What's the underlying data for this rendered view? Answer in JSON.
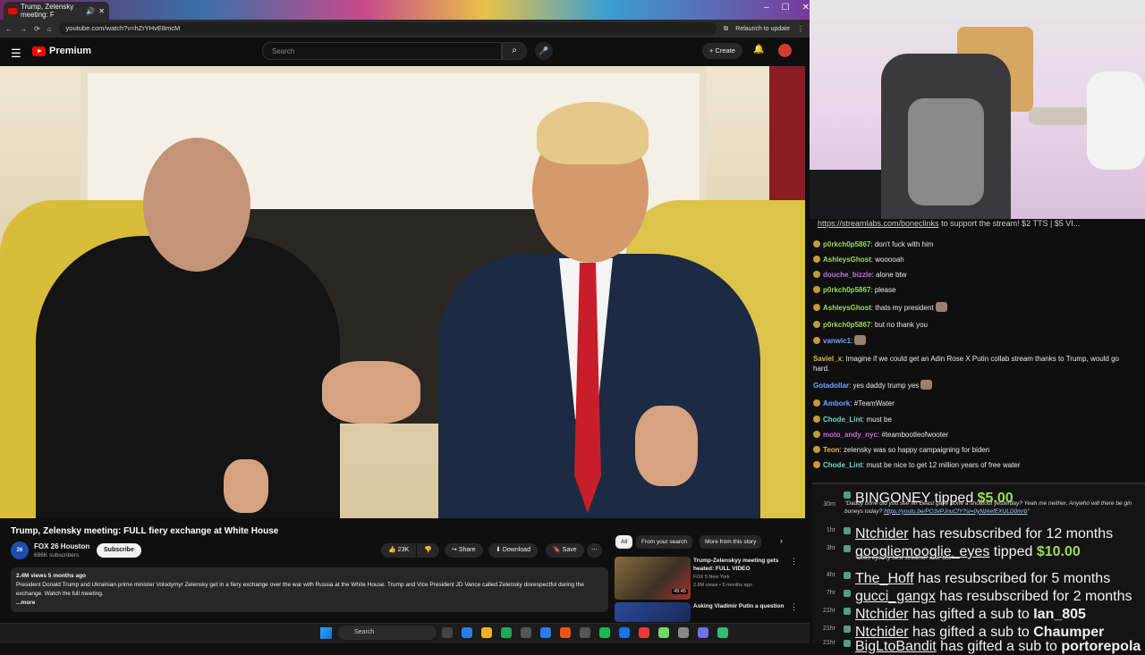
{
  "browser": {
    "tab_title": "Trump, Zelensky meeting: F",
    "url": "youtube.com/watch?v=hZrYHvE8mcM",
    "relaunch": "Relaunch to update"
  },
  "yt": {
    "brand": "Premium",
    "search_placeholder": "Search",
    "create": "Create"
  },
  "video": {
    "title": "Trump, Zelensky meeting: FULL fiery exchange at White House",
    "channel": "FOX 26 Houston",
    "subs": "686K subscribers",
    "subscribe": "Subscribe",
    "likes": "23K",
    "share": "Share",
    "download": "Download",
    "save": "Save",
    "meta": "2.4M views  5 months ago",
    "description": "President Donald Trump and Ukrainian prime minister Volodymyr Zelensky get in a fiery exchange over the war with Russia at the White House. Trump and Vice President JD Vance called Zelensky disrespectful during the exchange. Watch the full meeting.",
    "more": "...more"
  },
  "chips": [
    "All",
    "From your search",
    "More from this story"
  ],
  "recs": [
    {
      "title": "Trump-Zelenskyy meeting gets heated: FULL VIDEO",
      "channel": "FOX 5 New York",
      "meta": "2.8M views • 5 months ago",
      "duration": "49:45"
    },
    {
      "title": "Asking Vladimir Putin a question",
      "channel": "",
      "meta": "",
      "duration": ""
    }
  ],
  "stream": {
    "link_url": "https://streamlabs.com/boneclinks",
    "link_text": " to support the stream! $2 TTS | $5 VI..."
  },
  "chat": [
    {
      "user": "p0rkch0p5867",
      "color": "#9bdc55",
      "text": " don't fuck with him",
      "badge": true,
      "emote": false
    },
    {
      "user": "AshleysGhost",
      "color": "#9bdc55",
      "text": " wooooah",
      "badge": true,
      "emote": false
    },
    {
      "user": "douche_bizzle",
      "color": "#b67ad8",
      "text": " alone btw",
      "badge": true,
      "emote": false
    },
    {
      "user": "p0rkch0p5867",
      "color": "#9bdc55",
      "text": " please",
      "badge": true,
      "emote": false
    },
    {
      "user": "AshleysGhost",
      "color": "#9bdc55",
      "text": " thats my president",
      "badge": true,
      "emote": true
    },
    {
      "user": "p0rkch0p5867",
      "color": "#9bdc55",
      "text": " but no thank you",
      "badge": true,
      "emote": false
    },
    {
      "user": "vanwic1",
      "color": "#6fa8ff",
      "text": "",
      "badge": true,
      "emote": true
    },
    {
      "user": "Saviel_x",
      "color": "#e8b84a",
      "text": " Imagine if we could get an Adin Rose X Putin collab stream thanks to Trump, would go hard.",
      "badge": false,
      "emote": false
    },
    {
      "user": "Gotadollar",
      "color": "#6fa8ff",
      "text": " yes daddy trump yes",
      "badge": false,
      "emote": true
    },
    {
      "user": "Ambork",
      "color": "#6fa8ff",
      "text": " #TeamWater",
      "badge": true,
      "emote": false
    },
    {
      "user": "Chode_Lint",
      "color": "#6fd8c8",
      "text": " must be",
      "badge": true,
      "emote": false
    },
    {
      "user": "moto_andy_nyc",
      "color": "#c86ad8",
      "text": " #teambootleofwooter",
      "badge": true,
      "emote": false
    },
    {
      "user": "Teon",
      "color": "#e8b84a",
      "text": " zelensky was so happy campaigning for biden",
      "badge": true,
      "emote": false
    },
    {
      "user": "Chode_Lint",
      "color": "#6fd8c8",
      "text": " must be nice to get 12 million years of free water",
      "badge": true,
      "emote": false
    }
  ],
  "feed": {
    "tip1": {
      "name": "BINGONEY",
      "action": " tipped ",
      "amount": "$5.00",
      "time": "30m",
      "quote": "\"Daddy bone did you see Mr Beast gave Bone a shoutout yesterday? Yeah me neither. Anywho will there be gin boneys today? ",
      "link": "https://youtu.be/PO3vPJnuCfY?si=0yNzkefEXULD0mrb",
      "quote_end": "\""
    },
    "rows": [
      {
        "time": "1hr",
        "name": "Ntchider",
        "text": " has resubscribed for 12 months"
      },
      {
        "time": "3hr",
        "name": "googliemooglie_eyes",
        "text": " tipped ",
        "amount": "$10.00",
        "quote": "\"xfiles eyes ty best streamer ever btw\""
      },
      {
        "time": "4hr",
        "name": "The_Hoff",
        "text": " has resubscribed for 5 months"
      },
      {
        "time": "7hr",
        "name": "gucci_gangx",
        "text": " has resubscribed for 2 months"
      },
      {
        "time": "21hr",
        "name": "Ntchider",
        "text": " has gifted a sub to ",
        "target": "Ian_805"
      },
      {
        "time": "21hr",
        "name": "Ntchider",
        "text": " has gifted a sub to ",
        "target": "Chaumper"
      },
      {
        "time": "21hr",
        "name": "BigLtoBandit",
        "text": " has gifted a sub to ",
        "target": "portorepola"
      }
    ]
  },
  "taskbar": {
    "search": "Search"
  },
  "colors": {
    "accent": "#ff0000",
    "bg": "#0f0f0f",
    "tip": "#9bdc55"
  }
}
